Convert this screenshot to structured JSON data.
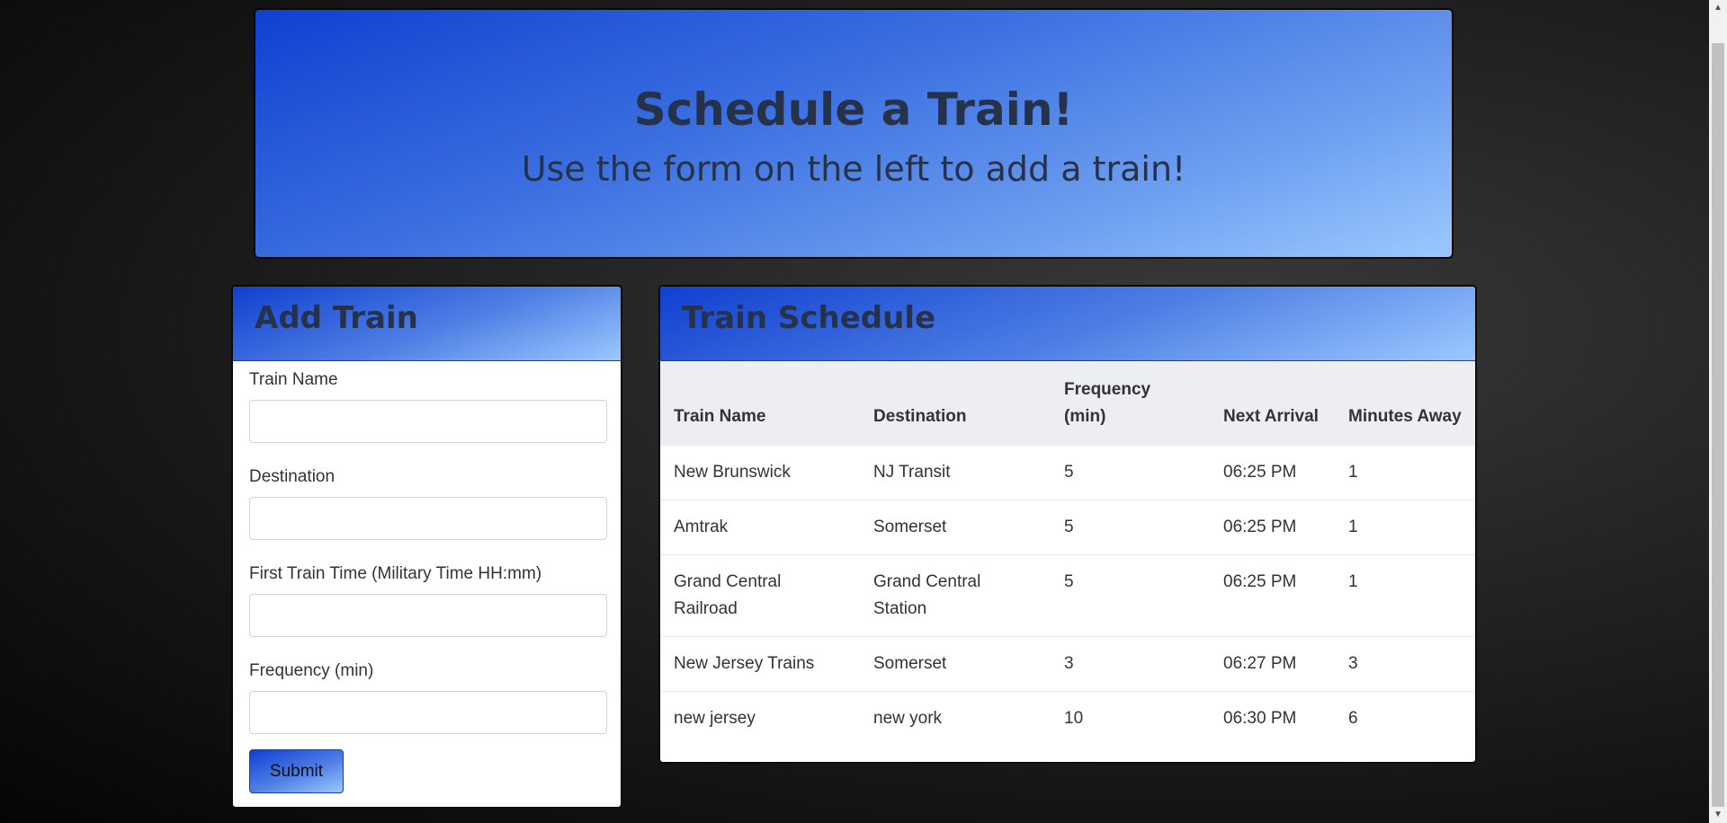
{
  "jumbotron": {
    "title": "Schedule a Train!",
    "subtitle": "Use the form on the left to add a train!"
  },
  "add_train": {
    "header": "Add Train",
    "fields": [
      {
        "label": "Train Name",
        "value": ""
      },
      {
        "label": "Destination",
        "value": ""
      },
      {
        "label": "First Train Time (Military Time HH:mm)",
        "value": ""
      },
      {
        "label": "Frequency (min)",
        "value": ""
      }
    ],
    "submit_label": "Submit"
  },
  "schedule": {
    "header": "Train Schedule",
    "columns": [
      "Train Name",
      "Destination",
      "Frequency (min)",
      "Next Arrival",
      "Minutes Away"
    ],
    "rows": [
      [
        "New Brunswick",
        "NJ Transit",
        "5",
        "06:25 PM",
        "1"
      ],
      [
        "Amtrak",
        "Somerset",
        "5",
        "06:25 PM",
        "1"
      ],
      [
        "Grand Central Railroad",
        "Grand Central Station",
        "5",
        "06:25 PM",
        "1"
      ],
      [
        "New Jersey Trains",
        "Somerset",
        "3",
        "06:27 PM",
        "3"
      ],
      [
        "new jersey",
        "new york",
        "10",
        "06:30 PM",
        "6"
      ]
    ]
  },
  "scrollbar": {
    "up_icon": "triangle-up-icon",
    "down_icon": "triangle-down-icon"
  },
  "colors": {
    "accent_dark": "#1040d0",
    "accent_light": "#9cc8ff",
    "heading_text": "#25324a"
  }
}
